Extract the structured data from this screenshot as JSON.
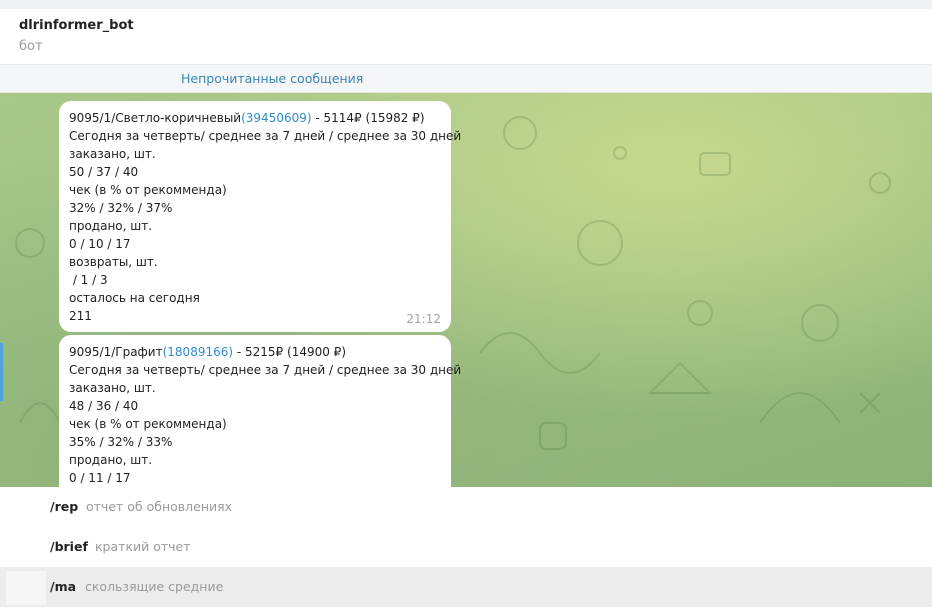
{
  "header": {
    "title": "dlrinformer_bot",
    "subtitle": "бот"
  },
  "unread_banner": "Непрочитанные сообщения",
  "messages": [
    {
      "line0_prefix": "9095/1/Светло-коричневый",
      "line0_link": "(39450609)",
      "line0_suffix": " - 5114₽ (15982 ₽)",
      "lines": [
        "Сегодня за четверть/ среднее за 7 дней / среднее за 30 дней",
        "заказано, шт.",
        "50 / 37 / 40",
        "чек (в % от рекомменда)",
        "32% / 32% / 37%",
        "продано, шт.",
        "0 / 10 / 17",
        "возвраты, шт.",
        " / 1 / 3",
        "осталось на сегодня",
        "211"
      ],
      "time": "21:12"
    },
    {
      "line0_prefix": "9095/1/Графит",
      "line0_link": "(18089166)",
      "line0_suffix": " - 5215₽ (14900 ₽)",
      "lines": [
        "Сегодня за четверть/ среднее за 7 дней / среднее за 30 дней",
        "заказано, шт.",
        "48 / 36 / 40",
        "чек (в % от рекомменда)",
        "35% / 32% / 33%",
        "продано, шт.",
        "0 / 11 / 17"
      ]
    }
  ],
  "commands": [
    {
      "name": "/rep",
      "description": "отчет об обновлениях"
    },
    {
      "name": "/brief",
      "description": "краткий отчет"
    },
    {
      "name": "/ma",
      "description": "скользящие средние"
    }
  ],
  "colors": {
    "link": "#2e8ccb",
    "accent": "#3a86b4",
    "chat_bg": "#9fc285"
  }
}
